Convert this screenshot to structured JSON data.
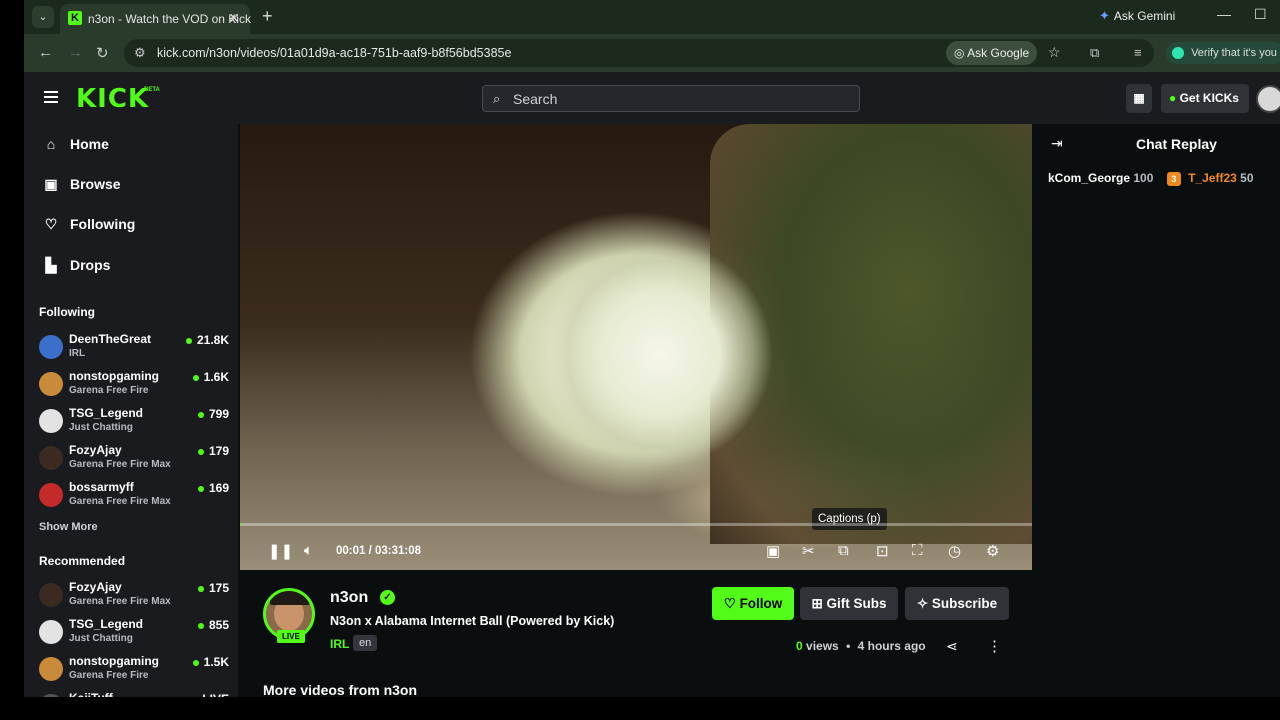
{
  "browser": {
    "tab_title": "n3on - Watch the VOD on Kick",
    "ask_gemini": "Ask Gemini",
    "url": "kick.com/n3on/videos/01a01d9a-ac18-751b-aaf9-b8f56bd5385e",
    "ask_google": "Ask Google",
    "verify": "Verify that it's you"
  },
  "header": {
    "logo": "KICK",
    "logo_beta": "BETA",
    "search_placeholder": "Search",
    "get_kicks": "Get KICKs"
  },
  "sidebar": {
    "nav": [
      {
        "label": "Home",
        "icon": "home-icon"
      },
      {
        "label": "Browse",
        "icon": "browse-icon"
      },
      {
        "label": "Following",
        "icon": "heart-icon"
      },
      {
        "label": "Drops",
        "icon": "drops-icon"
      }
    ],
    "following_heading": "Following",
    "following": [
      {
        "name": "DeenTheGreat",
        "category": "IRL",
        "viewers": "21.8K",
        "color": "#3b6fc9"
      },
      {
        "name": "nonstopgaming",
        "category": "Garena Free Fire",
        "viewers": "1.6K",
        "color": "#c98a3b"
      },
      {
        "name": "TSG_Legend",
        "category": "Just Chatting",
        "viewers": "799",
        "color": "#e3e3e3"
      },
      {
        "name": "FozyAjay",
        "category": "Garena Free Fire Max",
        "viewers": "179",
        "color": "#3a2a20"
      },
      {
        "name": "bossarmyff",
        "category": "Garena Free Fire Max",
        "viewers": "169",
        "color": "#c42a2a"
      }
    ],
    "show_more": "Show More",
    "recommended_heading": "Recommended",
    "recommended": [
      {
        "name": "FozyAjay",
        "category": "Garena Free Fire Max",
        "viewers": "175",
        "color": "#3a2a20"
      },
      {
        "name": "TSG_Legend",
        "category": "Just Chatting",
        "viewers": "855",
        "color": "#e3e3e3"
      },
      {
        "name": "nonstopgaming",
        "category": "Garena Free Fire",
        "viewers": "1.5K",
        "color": "#c98a3b"
      },
      {
        "name": "KaiiTuff",
        "category": "",
        "viewers": "LIVE",
        "color": "#555555"
      }
    ]
  },
  "player": {
    "caption_tooltip": "Captions (p)",
    "time": "00:01 / 03:31:08",
    "progress_fraction": 0.0001
  },
  "chat": {
    "title": "Chat Replay",
    "user1": "kCom_George",
    "amount1": "100",
    "badge": "3",
    "user2": "T_Jeff23",
    "amount2": "50"
  },
  "stream_info": {
    "channel": "n3on",
    "live_badge": "LIVE",
    "title": "N3on x Alabama Internet Ball (Powered by Kick)",
    "category": "IRL",
    "language": "en",
    "follow": "Follow",
    "gift_subs": "Gift Subs",
    "subscribe": "Subscribe",
    "views_count": "0",
    "views_label": "views",
    "separator": "•",
    "ago": "4 hours ago",
    "more_videos": "More videos from n3on"
  },
  "colors": {
    "accent": "#53fc18",
    "background": "#0b0e0f",
    "panel": "#191b1f"
  }
}
